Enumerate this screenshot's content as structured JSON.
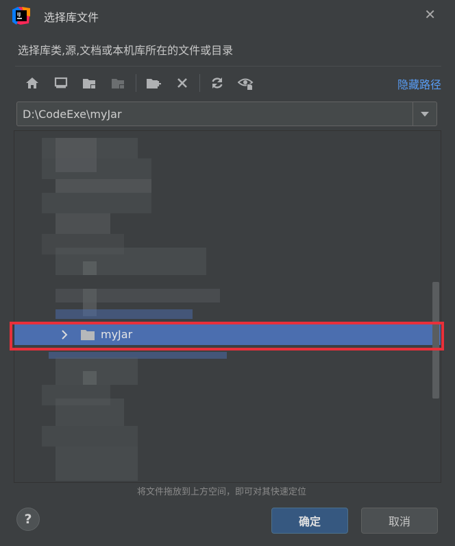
{
  "dialog": {
    "title": "选择库文件",
    "description": "选择库类,源,文档或本机库所在的文件或目录",
    "close_icon": "close-icon",
    "app_icon": "intellij-idea-icon"
  },
  "toolbar": {
    "buttons": [
      "home-icon",
      "desktop-icon",
      "project-folder-icon",
      "module-folder-icon",
      "new-folder-icon",
      "delete-icon",
      "refresh-icon",
      "show-hidden-icon"
    ],
    "hide_path_label": "隐藏路径"
  },
  "path": {
    "value": "D:\\CodeExe\\myJar"
  },
  "tree": {
    "selected_item": {
      "label": "myJar",
      "expanded": false
    }
  },
  "hint": "将文件拖放到上方空间，即可对其快速定位",
  "footer": {
    "help_label": "?",
    "ok_label": "确定",
    "cancel_label": "取消"
  },
  "colors": {
    "selection": "#4b6eaf",
    "link": "#589df6",
    "highlight_box": "#e8303a",
    "primary_button": "#365880"
  }
}
